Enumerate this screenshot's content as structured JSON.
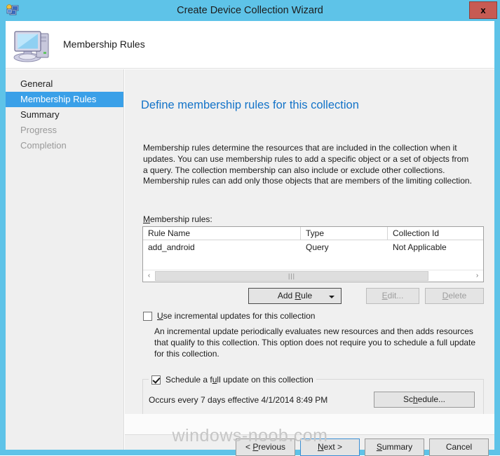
{
  "window": {
    "title": "Create Device Collection Wizard",
    "icon": "collection-icon",
    "close_label": "x",
    "accent_color": "#5ec3e8",
    "close_color": "#c75b53"
  },
  "banner": {
    "title": "Membership Rules",
    "icon": "computer-icon"
  },
  "sidebar": {
    "items": [
      {
        "label": "General",
        "state": "normal"
      },
      {
        "label": "Membership Rules",
        "state": "active"
      },
      {
        "label": "Summary",
        "state": "normal"
      },
      {
        "label": "Progress",
        "state": "disabled"
      },
      {
        "label": "Completion",
        "state": "disabled"
      }
    ],
    "active_color": "#3aa0e8"
  },
  "main": {
    "heading": "Define membership rules for this collection",
    "heading_color": "#1373c8",
    "description": "Membership rules determine the resources that are included in the collection when it updates. You can use membership rules to add a specific object or a set of objects from a query. The collection membership can also include or exclude other collections. Membership rules can add only those objects that are members of the limiting collection.",
    "rules_label_accel": "M",
    "rules_label_rest": "embership rules:",
    "table": {
      "columns": [
        "Rule Name",
        "Type",
        "Collection Id"
      ],
      "rows": [
        [
          "add_android",
          "Query",
          "Not Applicable"
        ]
      ]
    },
    "scrollbar": {
      "left_arrow": "‹",
      "right_arrow": "›",
      "grip": "|||"
    },
    "buttons": {
      "add_rule_accel_before": "Add ",
      "add_rule_accel": "R",
      "add_rule_after": "ule",
      "edit_accel": "E",
      "edit_after": "dit...",
      "delete_accel": "D",
      "delete_after": "elete"
    },
    "incremental": {
      "checked": false,
      "accel": "U",
      "label_rest": "se incremental updates for this collection",
      "description": "An incremental update periodically evaluates new resources and then adds resources that qualify to this collection. This option does not require you to schedule a full update for this collection."
    },
    "schedule": {
      "checked": true,
      "caption_before": "Schedule a f",
      "caption_accel": "u",
      "caption_after": "ll update on this collection",
      "occurs_text": "Occurs every 7 days effective 4/1/2014 8:49 PM",
      "button_before": "Sc",
      "button_accel": "h",
      "button_after": "edule..."
    }
  },
  "footer": {
    "previous_before": "< ",
    "previous_accel": "P",
    "previous_after": "revious",
    "next_accel": "N",
    "next_after": "ext >",
    "summary_accel": "S",
    "summary_after": "ummary",
    "cancel_label": "Cancel"
  },
  "watermark": "windows-noob.com"
}
